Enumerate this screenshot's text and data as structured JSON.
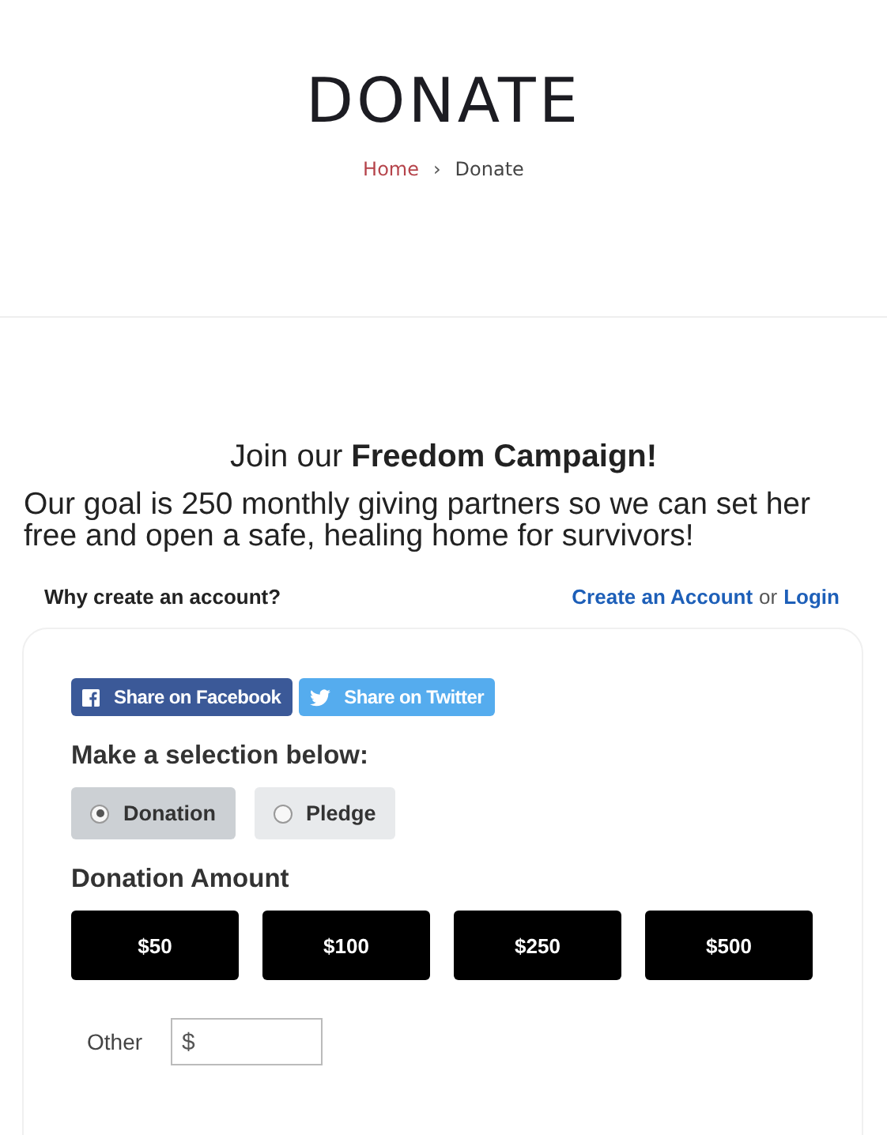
{
  "page_title": "DONATE",
  "breadcrumb": [
    {
      "label": "Home",
      "kind": "link"
    },
    {
      "label": "›",
      "kind": "separator"
    },
    {
      "label": "Donate",
      "kind": "current"
    }
  ],
  "campaign": {
    "heading": "Join our **Freedom Campaign!**",
    "goal": "Our goal is 250 monthly giving partners so we can set her free and open a safe, healing home for survivors!"
  },
  "account": {
    "question": "Why create an account?",
    "create_link": "Create an Account",
    "or": "or",
    "login_link": "Login"
  },
  "share_buttons": [
    {
      "label": "Share on Facebook",
      "kind": "facebook"
    },
    {
      "label": "Share on Twitter",
      "kind": "twitter"
    }
  ],
  "selection": {
    "heading": "Make a selection below:",
    "options": [
      {
        "label": "Donation",
        "selected": true
      },
      {
        "label": "Pledge",
        "selected": false
      }
    ]
  },
  "amount": {
    "heading": "Donation Amount",
    "buttons": [
      "$50",
      "$100",
      "$250",
      "$500"
    ],
    "other_label": "Other",
    "currency": "$"
  }
}
